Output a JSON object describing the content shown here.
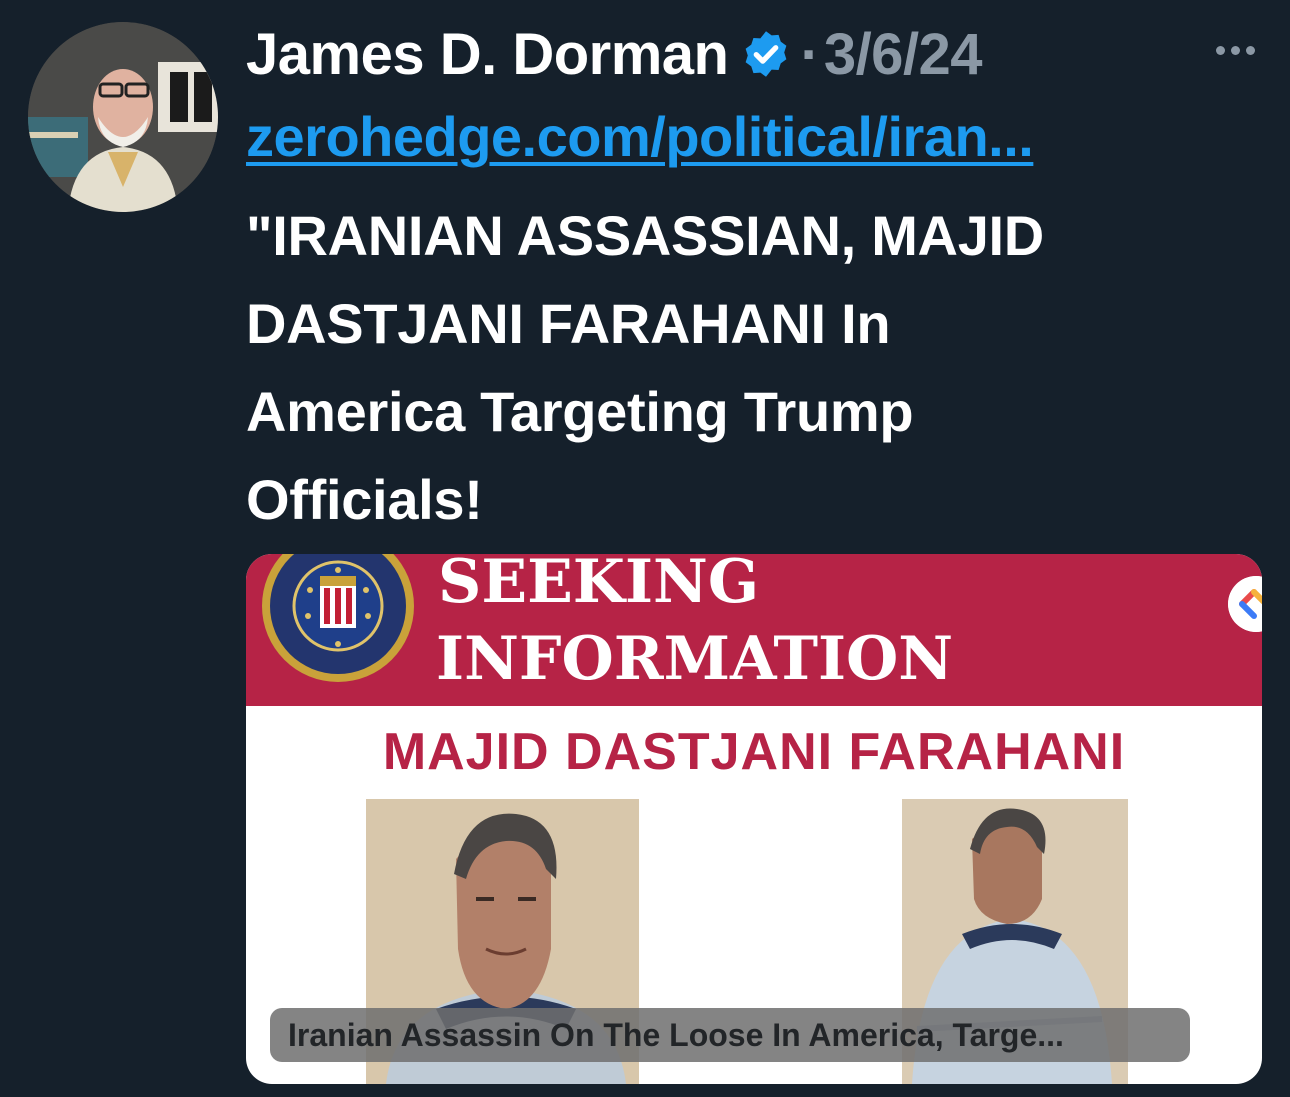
{
  "tweet": {
    "author_name": "James D. Dorman",
    "separator": "·",
    "date": "3/6/24",
    "link_text": "zerohedge.com/political/iran...",
    "text_lines": [
      "\"IRANIAN ASSASSIAN, MAJID",
      "DASTJANI FARAHANI In",
      "America Targeting Trump",
      "Officials!"
    ]
  },
  "card": {
    "banner_line1": "SEEKING",
    "banner_line2": "INFORMATION",
    "subject_name": "MAJID DASTJANI FARAHANI",
    "caption": "Iranian Assassin On The Loose In America, Targe..."
  },
  "colors": {
    "background": "#15202b",
    "link": "#1d9bf0",
    "muted": "#8b98a5",
    "banner": "#b62346",
    "verified": "#1d9bf0"
  },
  "icons": {
    "verified": "verified-badge-icon",
    "more": "more-options-icon",
    "seal": "fbi-seal",
    "share": "share-icon"
  }
}
